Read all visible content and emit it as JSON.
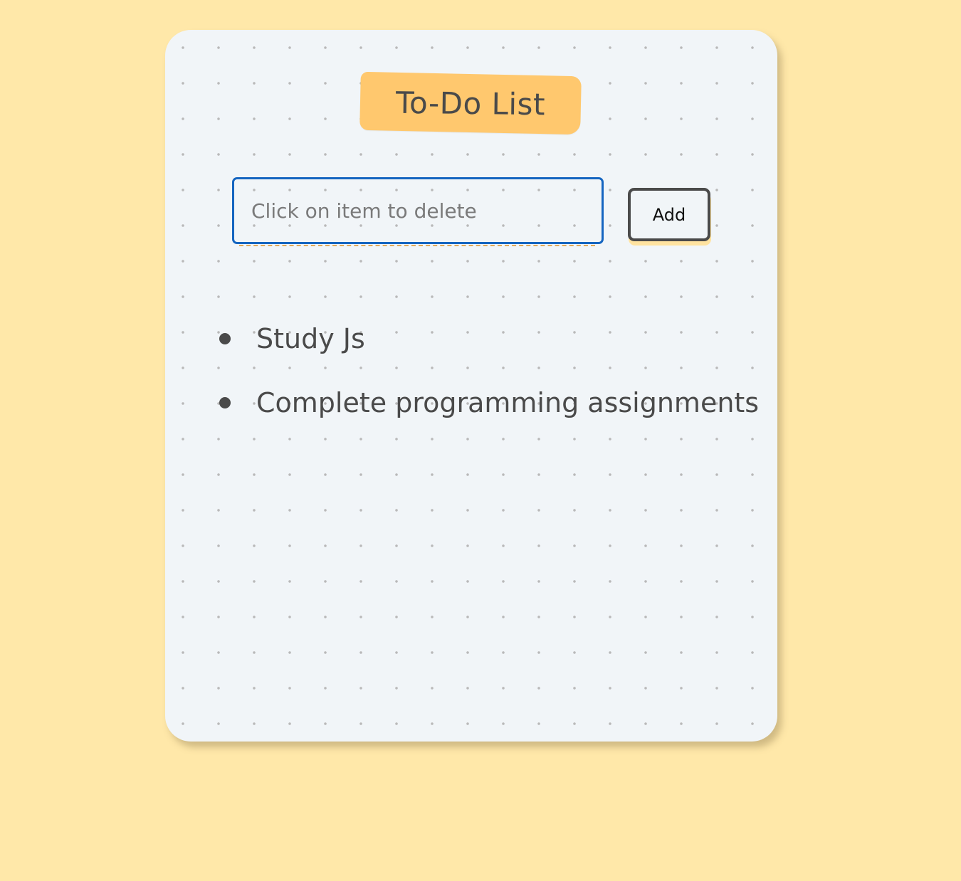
{
  "app": {
    "title": "To-Do List"
  },
  "input": {
    "placeholder": "Click on item to delete",
    "value": ""
  },
  "add_button": {
    "label": "Add"
  },
  "items": [
    {
      "label": "Study Js"
    },
    {
      "label": "Complete programming assignments"
    }
  ],
  "colors": {
    "background": "#ffe8a9",
    "card": "#f1f5f8",
    "title_tag": "#ffc86e",
    "input_border": "#1565c0",
    "text": "#4a4a4a"
  }
}
